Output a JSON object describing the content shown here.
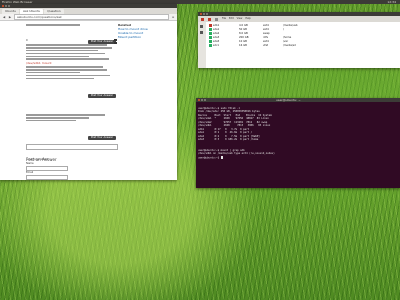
{
  "topbar": {
    "app_title": "Firefox Web Browser",
    "clock": "12:34"
  },
  "browser": {
    "tabs": [
      "Ubuntu",
      "Ask Ubuntu",
      "Question"
    ],
    "url": "askubuntu.com/questions/ask",
    "question": {
      "votes": "0",
      "status_label": "Linked",
      "highlight": "/dev/sdb1 mount",
      "add_comment": "add a comment",
      "answer_btn": "Post Your Answer",
      "your_answer": "Your Answer",
      "sidebar_title": "Related",
      "sidebar_links": [
        "How to mount drive",
        "Unable to mount",
        "Mount partition"
      ]
    },
    "form": {
      "title": "Post an Answer",
      "name_label": "Name",
      "email_label": "Email",
      "post_btn": "Post"
    }
  },
  "filemanager": {
    "menu": [
      "File",
      "Edit",
      "View",
      "Help"
    ],
    "rows": [
      {
        "name": "sdb1",
        "size": "4.0 GB",
        "type": "ext4",
        "mount": "/media/usb"
      },
      {
        "name": "sda1",
        "size": "50 GB",
        "type": "ext4",
        "mount": "/"
      },
      {
        "name": "sda2",
        "size": "8.0 GB",
        "type": "swap",
        "mount": ""
      },
      {
        "name": "sda3",
        "size": "200 GB",
        "type": "ntfs",
        "mount": "/home"
      },
      {
        "name": "sda5",
        "size": "10 GB",
        "type": "ext4",
        "mount": "/var"
      },
      {
        "name": "sdc1",
        "size": "16 GB",
        "type": "vfat",
        "mount": "/media/sd"
      }
    ]
  },
  "terminal": {
    "title": "user@ubuntu: ~",
    "lines": [
      "user@ubuntu:~$ sudo fdisk -l",
      "Disk /dev/sda: 250 GB, 250059350016 bytes",
      "Device     Boot  Start   End    Blocks  Id System",
      "/dev/sda1  *     2048    97656  48827  83 Linux",
      "/dev/sda2        97657  113281  7812   82 swap",
      "/dev/sdb1        2048     7813   3906   83 Linux",
      "sdb1       8:17   0   3.7G  0 part",
      "sda1       8:1    0  46.6G  0 part /",
      "sda2       8:2    0   7.5G  0 part [SWAP]",
      "sda3       8:3    0 186.2G  0 part /home",
      "",
      "",
      "user@ubuntu:~$ mount | grep sdb",
      "/dev/sdb1 on /media/usb type ext4 (rw,nosuid,nodev)",
      "user@ubuntu:~$ "
    ]
  }
}
